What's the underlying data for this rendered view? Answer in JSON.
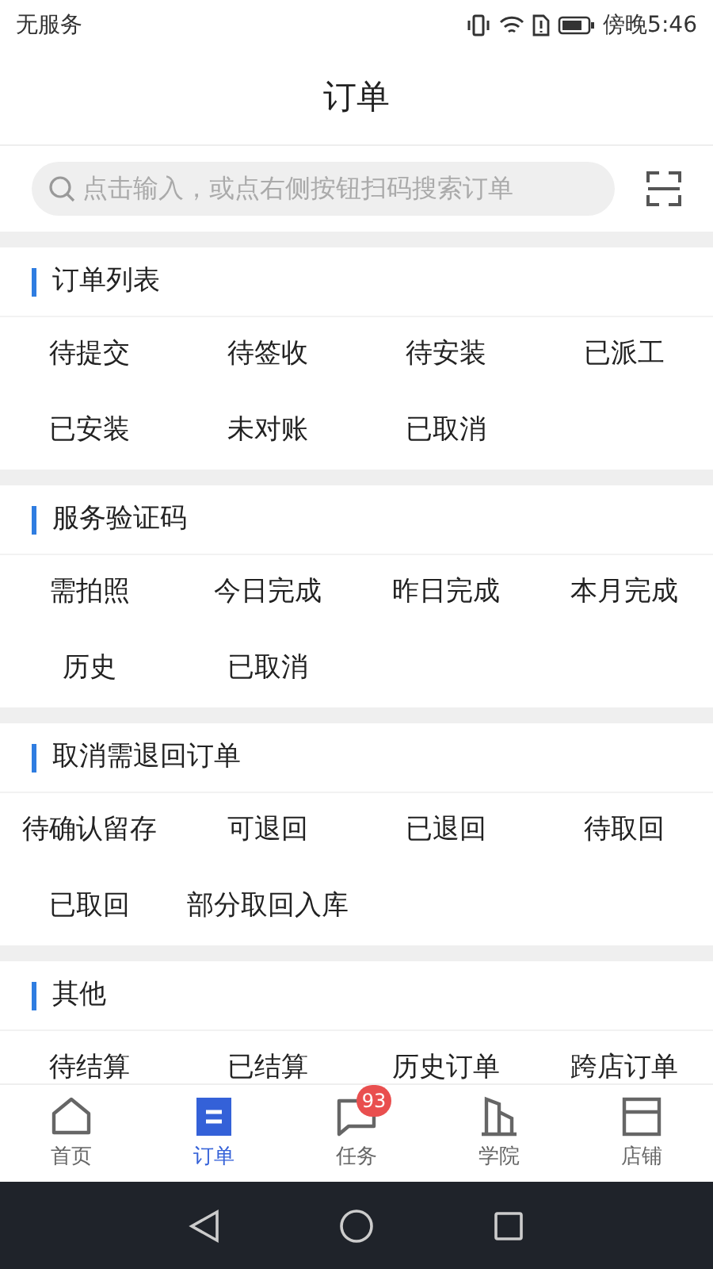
{
  "status_bar": {
    "carrier": "无服务",
    "time": "傍晚5:46"
  },
  "header": {
    "title": "订单"
  },
  "search": {
    "placeholder": "点击输入，或点右侧按钮扫码搜索订单"
  },
  "sections": [
    {
      "title": "订单列表",
      "items": [
        "待提交",
        "待签收",
        "待安装",
        "已派工",
        "已安装",
        "未对账",
        "已取消"
      ]
    },
    {
      "title": "服务验证码",
      "items": [
        "需拍照",
        "今日完成",
        "昨日完成",
        "本月完成",
        "历史",
        "已取消"
      ]
    },
    {
      "title": "取消需退回订单",
      "items": [
        "待确认留存",
        "可退回",
        "已退回",
        "待取回",
        "已取回",
        "部分取回入库"
      ]
    },
    {
      "title": "其他",
      "items": [
        "待结算",
        "已结算",
        "历史订单",
        "跨店订单"
      ]
    }
  ],
  "tab_bar": [
    {
      "kind": "home",
      "label": "首页",
      "selected": false
    },
    {
      "kind": "orders",
      "label": "订单",
      "selected": true
    },
    {
      "kind": "tasks",
      "label": "任务",
      "selected": false,
      "badge": "93"
    },
    {
      "kind": "academy",
      "label": "学院",
      "selected": false
    },
    {
      "kind": "store",
      "label": "店铺",
      "selected": false
    }
  ]
}
